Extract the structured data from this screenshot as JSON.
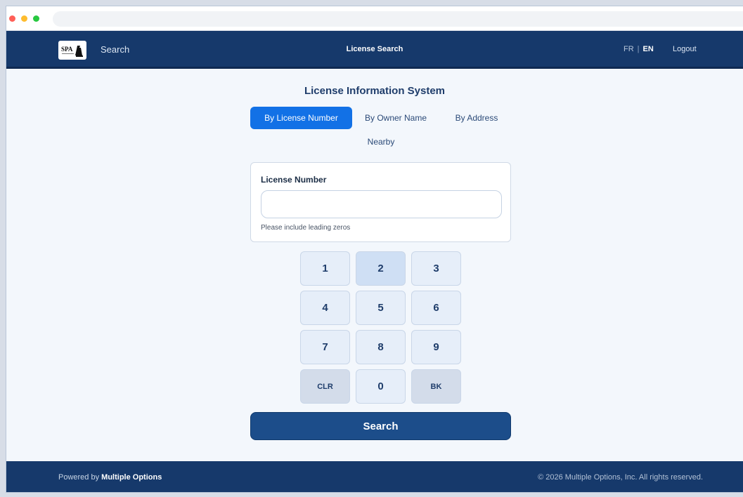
{
  "header": {
    "logo_text": "SPA",
    "nav_search": "Search",
    "title": "License Search",
    "lang_fr": "FR",
    "lang_sep": "|",
    "lang_en": "EN",
    "logout": "Logout"
  },
  "main": {
    "title": "License Information System",
    "tabs": [
      {
        "label": "By License Number",
        "active": true
      },
      {
        "label": "By Owner Name",
        "active": false
      },
      {
        "label": "By Address",
        "active": false
      },
      {
        "label": "Nearby",
        "active": false
      }
    ],
    "form": {
      "label": "License Number",
      "value": "",
      "placeholder": "",
      "hint": "Please include leading zeros"
    },
    "keypad": [
      "1",
      "2",
      "3",
      "4",
      "5",
      "6",
      "7",
      "8",
      "9",
      "CLR",
      "0",
      "BK"
    ],
    "search_button": "Search"
  },
  "footer": {
    "powered_prefix": "Powered by",
    "powered_brand": "Multiple Options",
    "copyright": "© 2026 Multiple Options, Inc. All rights reserved."
  },
  "colors": {
    "header_bg": "#16396b",
    "accent": "#1271e6",
    "search_button": "#1c4d8a"
  }
}
